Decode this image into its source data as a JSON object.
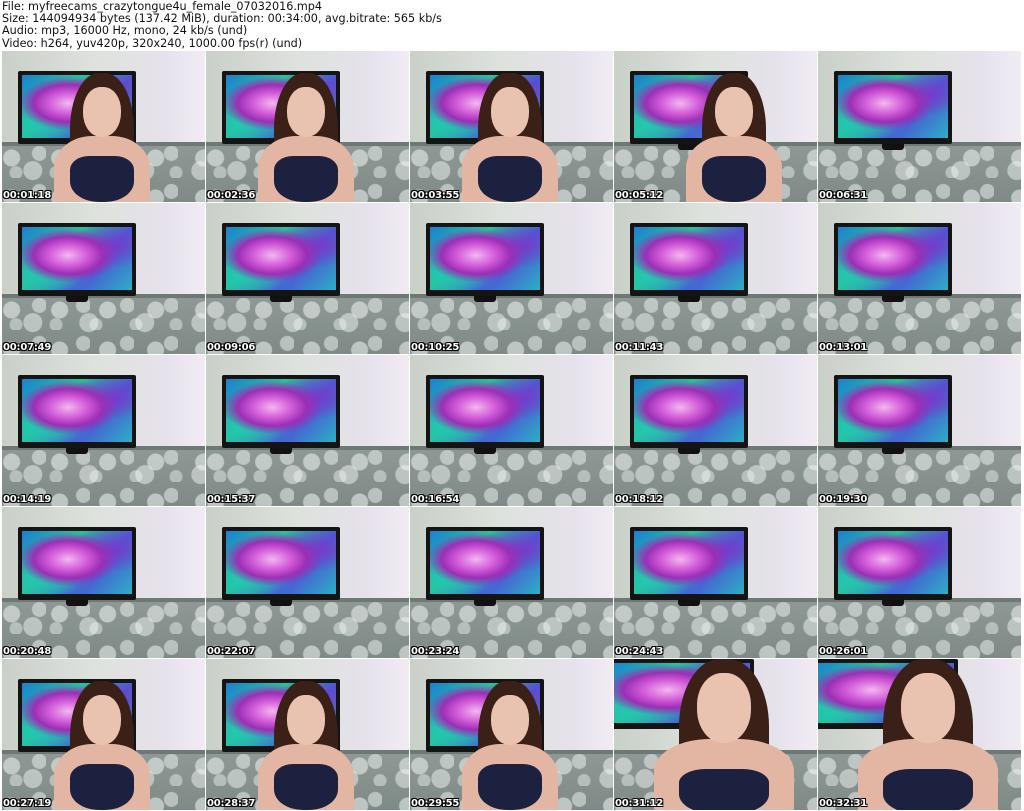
{
  "header": {
    "file": "File: myfreecams_crazytongue4u_female_07032016.mp4",
    "size": "Size: 144094934 bytes (137.42 MiB), duration: 00:34:00, avg.bitrate: 565 kb/s",
    "audio": "Audio: mp3, 16000 Hz, mono, 24 kb/s (und)",
    "video": "Video: h264, yuv420p, 320x240, 1000.00 fps(r) (und)"
  },
  "thumbnails": [
    {
      "time": "00:01:18",
      "person": "center"
    },
    {
      "time": "00:02:36",
      "person": "center"
    },
    {
      "time": "00:03:55",
      "person": "center"
    },
    {
      "time": "00:05:12",
      "person": "center"
    },
    {
      "time": "00:06:31",
      "person": "none"
    },
    {
      "time": "00:07:49",
      "person": "none"
    },
    {
      "time": "00:09:06",
      "person": "none"
    },
    {
      "time": "00:10:25",
      "person": "none"
    },
    {
      "time": "00:11:43",
      "person": "none"
    },
    {
      "time": "00:13:01",
      "person": "none"
    },
    {
      "time": "00:14:19",
      "person": "none"
    },
    {
      "time": "00:15:37",
      "person": "none"
    },
    {
      "time": "00:16:54",
      "person": "none"
    },
    {
      "time": "00:18:12",
      "person": "none"
    },
    {
      "time": "00:19:30",
      "person": "none"
    },
    {
      "time": "00:20:48",
      "person": "none"
    },
    {
      "time": "00:22:07",
      "person": "none"
    },
    {
      "time": "00:23:24",
      "person": "none"
    },
    {
      "time": "00:24:43",
      "person": "none"
    },
    {
      "time": "00:26:01",
      "person": "none"
    },
    {
      "time": "00:27:19",
      "person": "center"
    },
    {
      "time": "00:28:37",
      "person": "center"
    },
    {
      "time": "00:29:55",
      "person": "center"
    },
    {
      "time": "00:31:12",
      "person": "closeup"
    },
    {
      "time": "00:32:31",
      "person": "closeup"
    }
  ]
}
